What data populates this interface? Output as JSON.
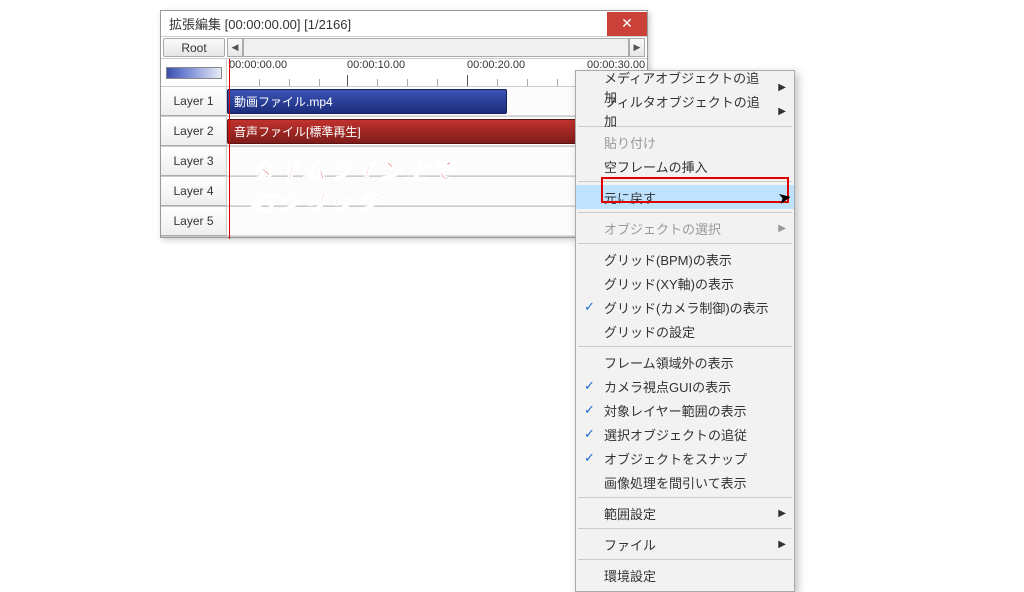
{
  "window": {
    "title": "拡張編集 [00:00:00.00] [1/2166]",
    "close_label": "✕",
    "root_button": "Root"
  },
  "ruler": {
    "ticks": [
      "00:00:00.00",
      "00:00:10.00",
      "00:00:20.00",
      "00:00:30.00"
    ]
  },
  "layers": [
    {
      "name": "Layer 1"
    },
    {
      "name": "Layer 2"
    },
    {
      "name": "Layer 3"
    },
    {
      "name": "Layer 4"
    },
    {
      "name": "Layer 5"
    }
  ],
  "clips": {
    "video_label": "動画ファイル.mp4",
    "audio_label": "音声ファイル[標準再生]"
  },
  "annotation": {
    "line1": "タイムライン上で",
    "line2": "右クリック"
  },
  "menu": {
    "add_media": "メディアオブジェクトの追加",
    "add_filter": "フィルタオブジェクトの追加",
    "paste": "貼り付け",
    "insert_empty": "空フレームの挿入",
    "undo": "元に戻す",
    "select_object": "オブジェクトの選択",
    "grid_bpm": "グリッド(BPM)の表示",
    "grid_xy": "グリッド(XY軸)の表示",
    "grid_camera": "グリッド(カメラ制御)の表示",
    "grid_settings": "グリッドの設定",
    "frame_outside": "フレーム領域外の表示",
    "camera_gui": "カメラ視点GUIの表示",
    "layer_range": "対象レイヤー範囲の表示",
    "follow_select": "選択オブジェクトの追従",
    "snap_object": "オブジェクトをスナップ",
    "thin_display": "画像処理を間引いて表示",
    "range_settings": "範囲設定",
    "file": "ファイル",
    "env_settings": "環境設定"
  }
}
